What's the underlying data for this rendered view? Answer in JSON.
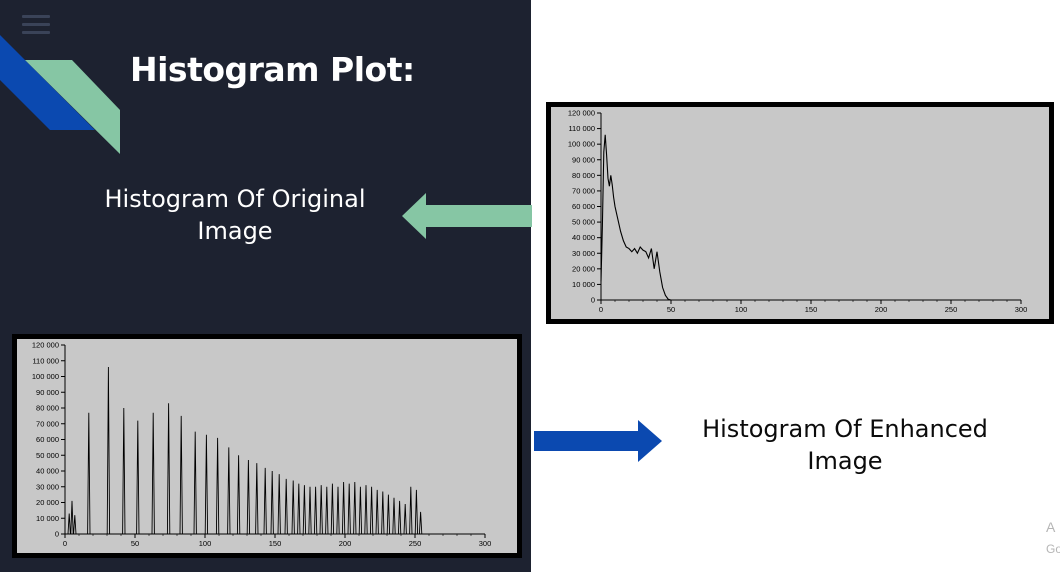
{
  "slide": {
    "title": "Histogram Plot:",
    "original_caption_line1": "Histogram Of Original",
    "original_caption_line2": "Image",
    "enhanced_caption_line1": "Histogram Of Enhanced",
    "enhanced_caption_line2": "Image",
    "side_text_line1": "A",
    "side_text_line2": "Go"
  },
  "colors": {
    "dark_panel": "#1d2230",
    "ribbon_blue": "#0b49b0",
    "ribbon_green": "#86c6a4",
    "arrow_green": "#86c6a4",
    "arrow_blue": "#0b49b0",
    "plot_bg": "#c8c8c8"
  },
  "chart_data": [
    {
      "type": "line",
      "title": "",
      "xlabel": "",
      "ylabel": "",
      "xlim": [
        0,
        300
      ],
      "ylim": [
        0,
        120000
      ],
      "x_ticks": [
        "0",
        "50",
        "100",
        "150",
        "200",
        "250",
        "300"
      ],
      "y_ticks": [
        "0",
        "10 000",
        "20 000",
        "30 000",
        "40 000",
        "50 000",
        "60 000",
        "70 000",
        "80 000",
        "90 000",
        "100 000",
        "110 000",
        "120 000"
      ],
      "series": [
        {
          "x": [
            0,
            1,
            2,
            3,
            4,
            5,
            6,
            7,
            8,
            9,
            10,
            12,
            14,
            16,
            18,
            20,
            22,
            24,
            26,
            28,
            30,
            32,
            34,
            36,
            38,
            40,
            42,
            44,
            46,
            48,
            50
          ],
          "y": [
            12000,
            48000,
            95000,
            106000,
            93000,
            78000,
            73000,
            80000,
            74000,
            66000,
            60000,
            52000,
            44000,
            38000,
            34000,
            33000,
            31000,
            33000,
            30000,
            34000,
            32000,
            31000,
            27000,
            33000,
            20000,
            31000,
            18000,
            8000,
            3000,
            500,
            0
          ]
        }
      ]
    },
    {
      "type": "line",
      "title": "",
      "xlabel": "",
      "ylabel": "",
      "xlim": [
        0,
        300
      ],
      "ylim": [
        0,
        120000
      ],
      "x_ticks": [
        "0",
        "50",
        "100",
        "150",
        "200",
        "250",
        "300"
      ],
      "y_ticks": [
        "0",
        "10 000",
        "20 000",
        "30 000",
        "40 000",
        "50 000",
        "60 000",
        "70 000",
        "80 000",
        "90 000",
        "100 000",
        "110 000",
        "120 000"
      ],
      "spikes": {
        "x": [
          3,
          5,
          7,
          17,
          31,
          42,
          52,
          63,
          74,
          83,
          93,
          101,
          109,
          117,
          124,
          131,
          137,
          143,
          148,
          153,
          158,
          163,
          167,
          171,
          175,
          179,
          183,
          187,
          191,
          195,
          199,
          203,
          207,
          211,
          215,
          219,
          223,
          227,
          231,
          235,
          239,
          243,
          247,
          251,
          254
        ],
        "y": [
          13000,
          21000,
          12000,
          77000,
          106000,
          80000,
          72000,
          77000,
          83000,
          75000,
          65000,
          63000,
          61000,
          55000,
          50000,
          47000,
          45000,
          42000,
          40000,
          38000,
          35000,
          34000,
          32000,
          31000,
          30000,
          30000,
          31000,
          30000,
          32000,
          30000,
          33000,
          32000,
          33000,
          30000,
          31000,
          30000,
          28000,
          27000,
          25000,
          23000,
          21000,
          19000,
          30000,
          28000,
          14000
        ]
      }
    }
  ]
}
